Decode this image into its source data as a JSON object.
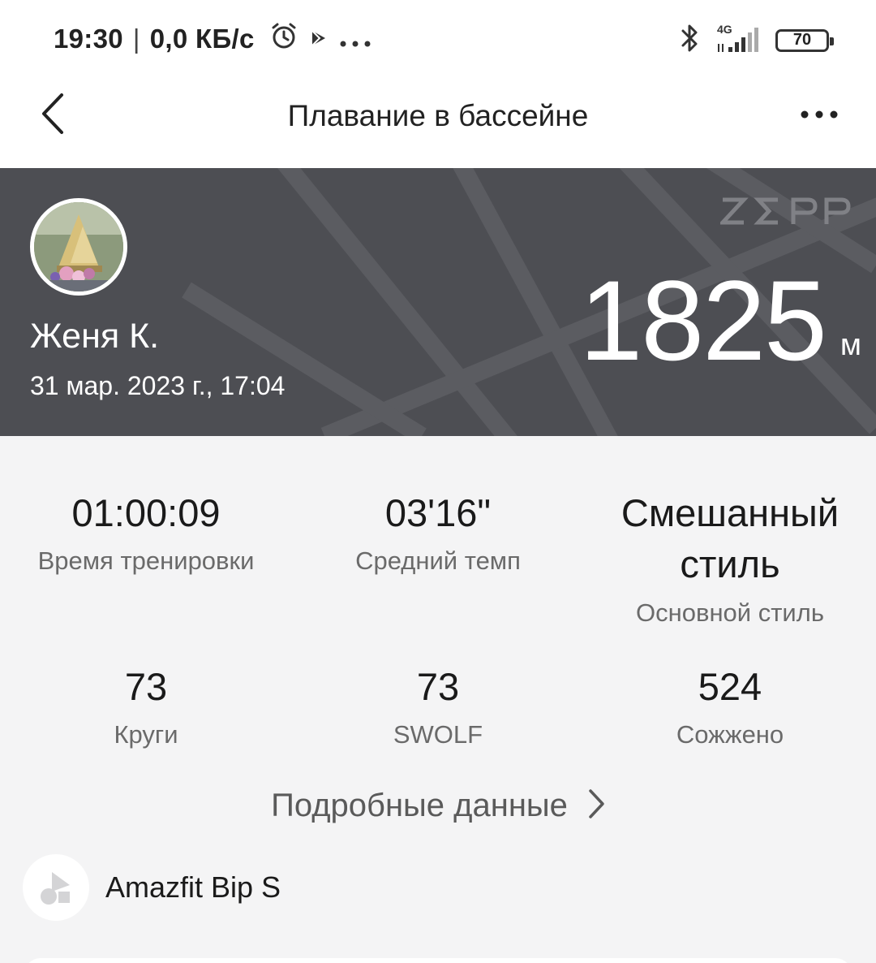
{
  "status_bar": {
    "time": "19:30",
    "separator": "|",
    "network_speed": "0,0 КБ/с",
    "network_type": "4G",
    "battery_level": "70",
    "icons": [
      "alarm-icon",
      "play-store-icon",
      "more-notifications-icon",
      "bluetooth-icon",
      "signal-icon",
      "battery-icon"
    ]
  },
  "header": {
    "title": "Плавание в бассейне",
    "back_icon": "chevron-left-icon",
    "more_icon": "more-horizontal-icon"
  },
  "hero": {
    "user_name": "Женя К.",
    "date": "31 мар. 2023 г., 17:04",
    "brand": "ZEPP",
    "distance": "1825",
    "distance_unit": "м",
    "background_color": "#4d4e53"
  },
  "stats": [
    {
      "value": "01:00:09",
      "label": "Время тренировки"
    },
    {
      "value": "03'16\"",
      "label": "Средний темп"
    },
    {
      "value": "Смешанный стиль",
      "label": "Основной стиль"
    },
    {
      "value": "73",
      "label": "Круги"
    },
    {
      "value": "73",
      "label": "SWOLF"
    },
    {
      "value": "524",
      "label": "Сожжено"
    }
  ],
  "details": {
    "label": "Подробные данные",
    "icon": "chevron-right-icon"
  },
  "device": {
    "name": "Amazfit Bip S",
    "icon": "device-shapes-icon"
  }
}
